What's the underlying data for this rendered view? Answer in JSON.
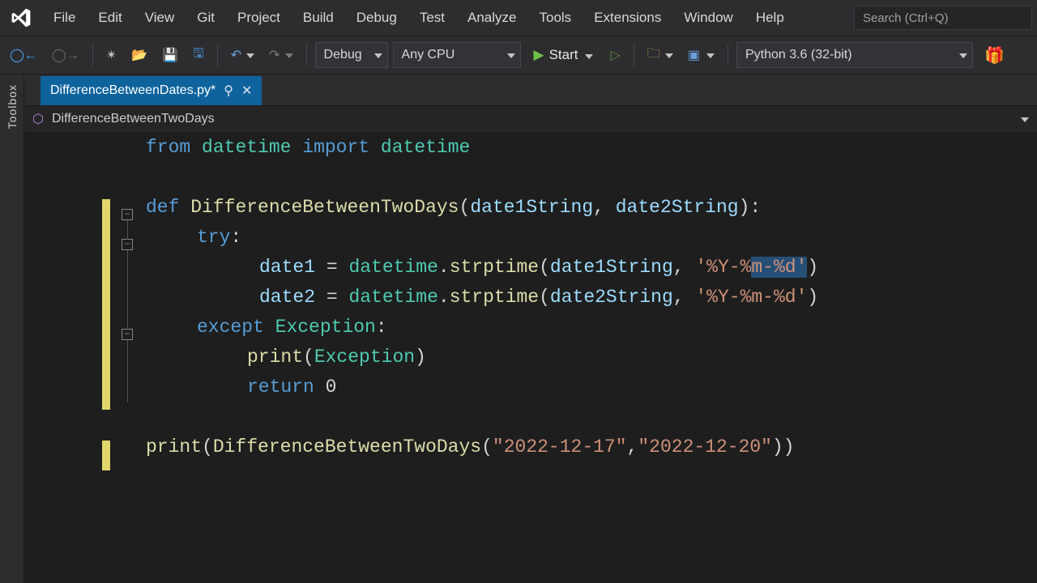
{
  "menu": {
    "items": [
      "File",
      "Edit",
      "View",
      "Git",
      "Project",
      "Build",
      "Debug",
      "Test",
      "Analyze",
      "Tools",
      "Extensions",
      "Window",
      "Help"
    ],
    "search_placeholder": "Search (Ctrl+Q)"
  },
  "toolbar": {
    "config": "Debug",
    "platform": "Any CPU",
    "start_label": "Start",
    "interpreter": "Python 3.6 (32-bit)"
  },
  "sidebar": {
    "toolbox_label": "Toolbox"
  },
  "tab": {
    "title": "DifferenceBetweenDates.py*"
  },
  "navbar": {
    "symbol": "DifferenceBetweenTwoDays"
  },
  "code": {
    "l1": {
      "kw1": "from",
      "mod": "datetime",
      "kw2": "import",
      "name": "datetime"
    },
    "l3": {
      "kw": "def",
      "fn": "DifferenceBetweenTwoDays",
      "p1": "date1String",
      "p2": "date2String"
    },
    "l4": {
      "kw": "try"
    },
    "l5": {
      "v": "date1",
      "cls": "datetime",
      "m": "strptime",
      "arg": "date1String",
      "fmt_a": "'%Y-%",
      "fmt_b": "m-%d'"
    },
    "l6": {
      "v": "date2",
      "cls": "datetime",
      "m": "strptime",
      "arg": "date2String",
      "fmt": "'%Y-%m-%d'"
    },
    "l7": {
      "kw": "except",
      "exc": "Exception"
    },
    "l8": {
      "fn": "print",
      "arg": "Exception"
    },
    "l9": {
      "kw": "return",
      "val": "0"
    },
    "l11": {
      "fn": "print",
      "call": "DifferenceBetweenTwoDays",
      "s1": "\"2022-12-17\"",
      "s2": "\"2022-12-20\""
    }
  }
}
